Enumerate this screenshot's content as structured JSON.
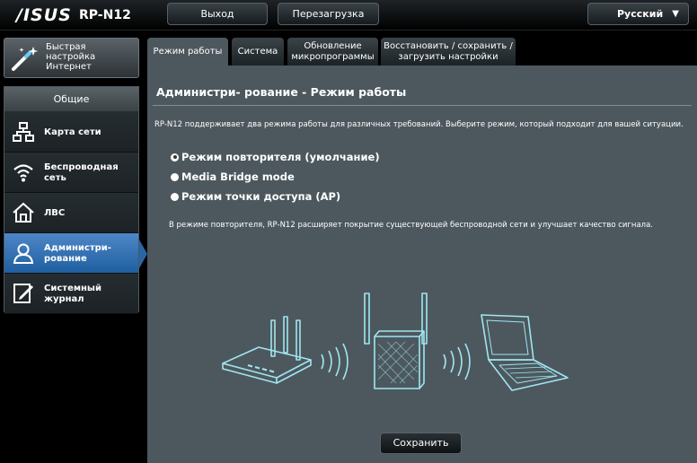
{
  "header": {
    "brand": "/ISUS",
    "model": "RP-N12",
    "logout_label": "Выход",
    "reboot_label": "Перезагрузка",
    "language": "Русский"
  },
  "sidebar": {
    "quick_setup": "Быстрая настройка Интернет",
    "section_title": "Общие",
    "items": [
      {
        "label": "Карта сети",
        "icon": "network-map-icon"
      },
      {
        "label": "Беспроводная сеть",
        "icon": "wireless-icon"
      },
      {
        "label": "ЛВС",
        "icon": "lan-icon"
      },
      {
        "label": "Администри- рование",
        "icon": "admin-icon",
        "active": true
      },
      {
        "label": "Системный журнал",
        "icon": "system-log-icon"
      }
    ]
  },
  "tabs": [
    {
      "label": "Режим работы",
      "active": true
    },
    {
      "label": "Система"
    },
    {
      "label": "Обновление микропрограммы"
    },
    {
      "label": "Восстановить / сохранить / загрузить настройки"
    }
  ],
  "main": {
    "title": "Администри- рование - Режим работы",
    "description": "RP-N12 поддерживает два режима работы для различных требований. Выберите режим, который подходит для вашей ситуации.",
    "modes": [
      {
        "label": "Режим повторителя (умолчание)",
        "selected": true
      },
      {
        "label": "Media Bridge mode",
        "selected": false
      },
      {
        "label": "Режим точки доступа (AP)",
        "selected": false
      }
    ],
    "mode_note": "В режиме повторителя, RP-N12 расширяет покрытие существующей беспроводной сети и улучшает качество сигнала.",
    "save_label": "Сохранить"
  },
  "colors": {
    "panel_bg": "#4d585e",
    "active_nav": "#2a66a6",
    "illustration_line": "#9fe6f2"
  }
}
